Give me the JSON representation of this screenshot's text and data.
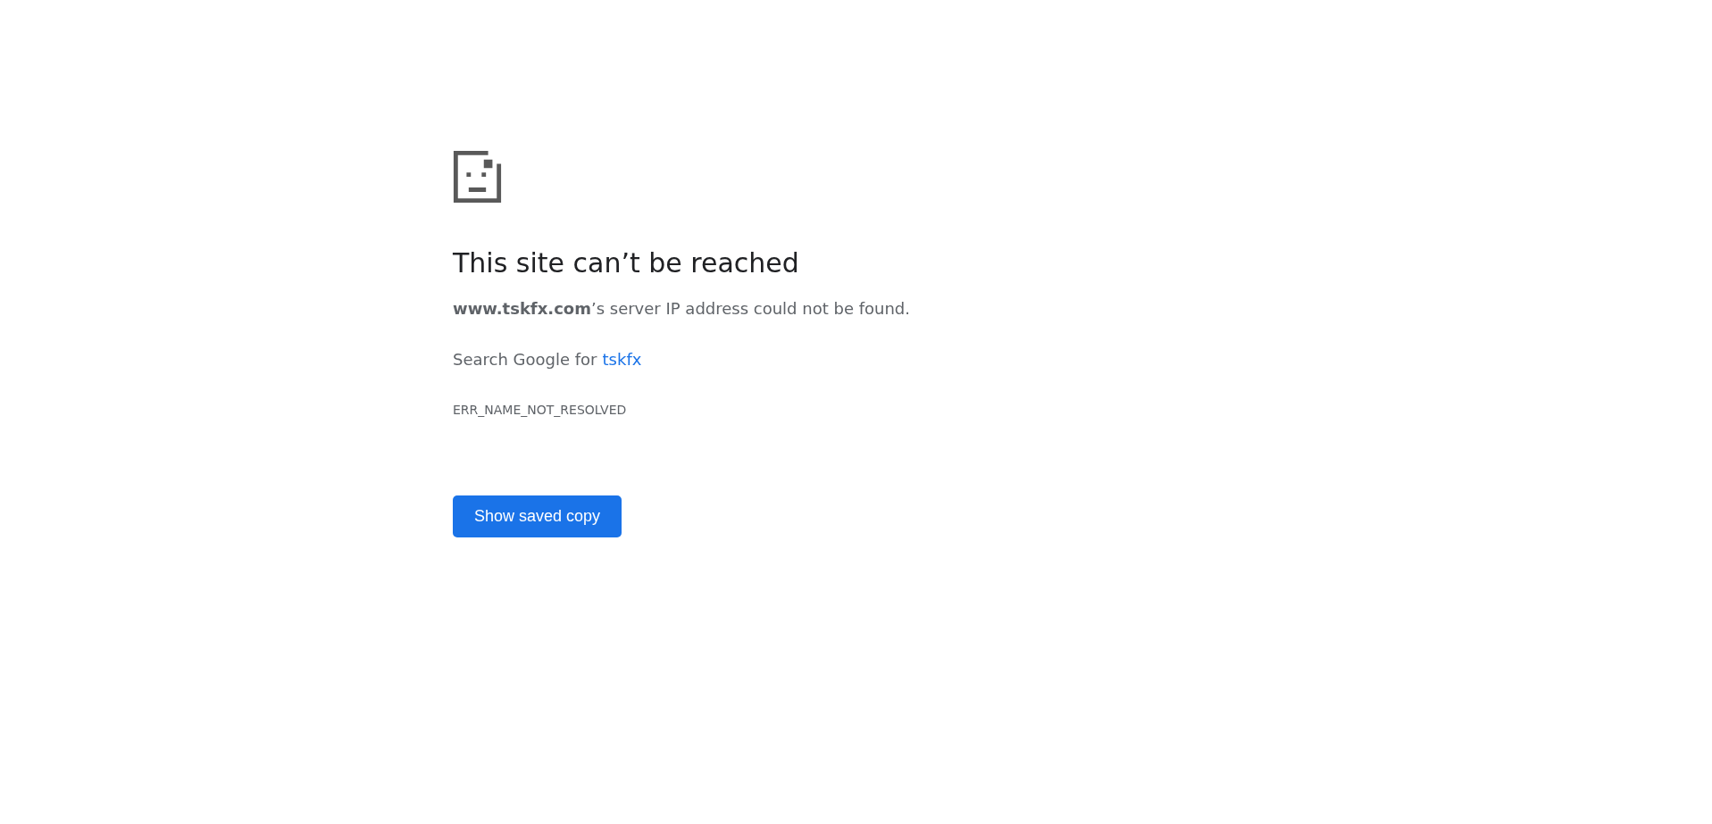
{
  "heading": "This site can’t be reached",
  "message": "**www.tskfx.com**’s server IP address could not be found.",
  "suggestion": {
    "text": "Search Google for",
    "link": "tskfx"
  },
  "error_code": "ERR_NAME_NOT_RESOLVED",
  "button": "Show saved copy"
}
